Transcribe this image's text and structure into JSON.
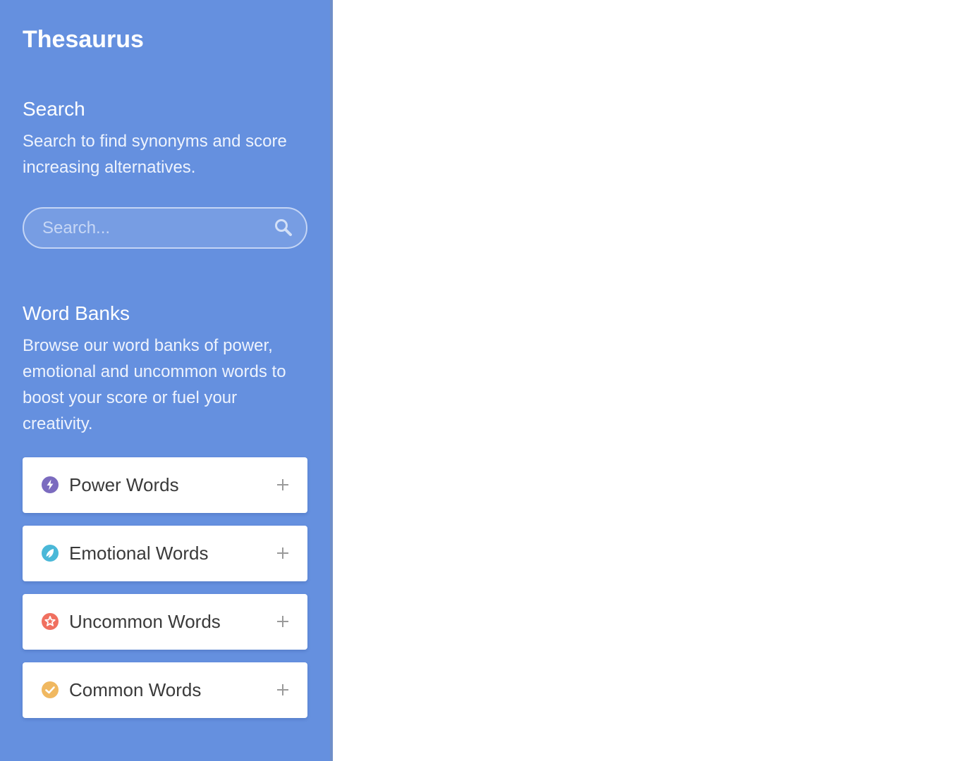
{
  "app": {
    "title": "Thesaurus"
  },
  "search": {
    "title": "Search",
    "description": "Search to find synonyms and score increasing alternatives.",
    "placeholder": "Search..."
  },
  "word_banks": {
    "title": "Word Banks",
    "description": "Browse our word banks of power, emotional and uncommon words to boost your score or fuel your creativity.",
    "items": [
      {
        "label": "Power Words",
        "icon": "lightning-icon",
        "color": "#7b6bbf"
      },
      {
        "label": "Emotional Words",
        "icon": "emotion-icon",
        "color": "#4ab8d8"
      },
      {
        "label": "Uncommon Words",
        "icon": "star-icon",
        "color": "#f07060"
      },
      {
        "label": "Common Words",
        "icon": "check-icon",
        "color": "#f0b860"
      }
    ]
  },
  "colors": {
    "sidebar": "#6590df",
    "main": "#ffffff"
  }
}
